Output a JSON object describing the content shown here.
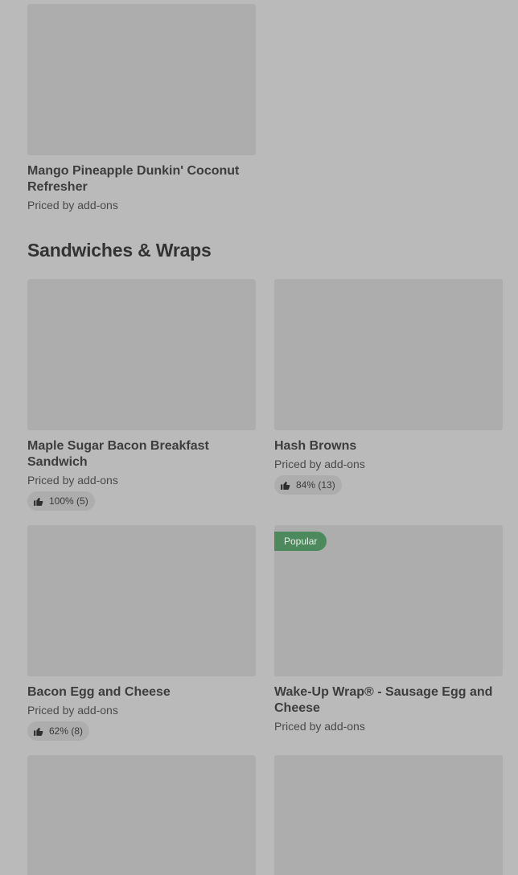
{
  "previous_section": {
    "items": [
      {
        "title": "Mango Pineapple Dunkin' Coconut Refresher",
        "price": "Priced by add-ons"
      }
    ]
  },
  "sandwiches_section": {
    "title": "Sandwiches & Wraps",
    "items": [
      {
        "title": "Maple Sugar Bacon Breakfast Sandwich",
        "price": "Priced by add-ons",
        "rating": "100% (5)"
      },
      {
        "title": "Hash Browns",
        "price": "Priced by add-ons",
        "rating": "84% (13)"
      },
      {
        "title": "Bacon Egg and Cheese",
        "price": "Priced by add-ons",
        "rating": "62% (8)"
      },
      {
        "title": "Wake-Up Wrap® - Sausage Egg and Cheese",
        "price": "Priced by add-ons",
        "badge": "Popular"
      }
    ]
  },
  "icons": {
    "rating": "thumbs-up-icon"
  },
  "colors": {
    "background": "#bababa",
    "placeholder": "#adadad",
    "popular_badge": "#4c8a5d"
  }
}
